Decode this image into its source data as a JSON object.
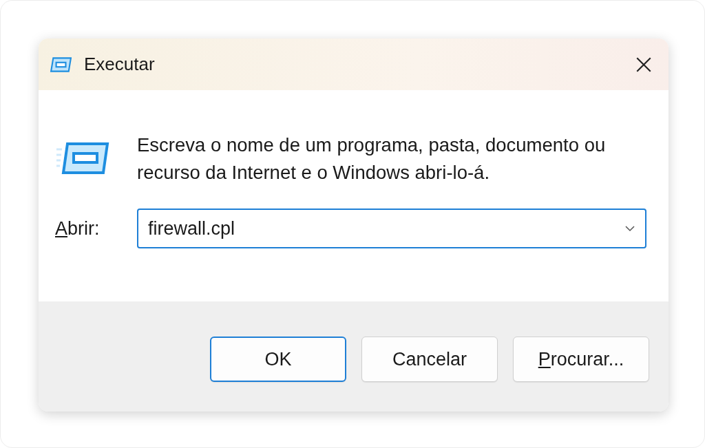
{
  "window": {
    "title": "Executar"
  },
  "message": "Escreva o nome de um programa, pasta, documento ou recurso da Internet e o Windows abri-lo-á.",
  "open_field": {
    "label": "Abrir:",
    "label_access_key_underlined": true,
    "value": "firewall.cpl"
  },
  "buttons": [
    {
      "label": "OK",
      "default": true,
      "access_key_underlined": false
    },
    {
      "label": "Cancelar",
      "default": false,
      "access_key_underlined": false
    },
    {
      "label": "Procurar...",
      "default": false,
      "access_key_underlined": true
    }
  ]
}
